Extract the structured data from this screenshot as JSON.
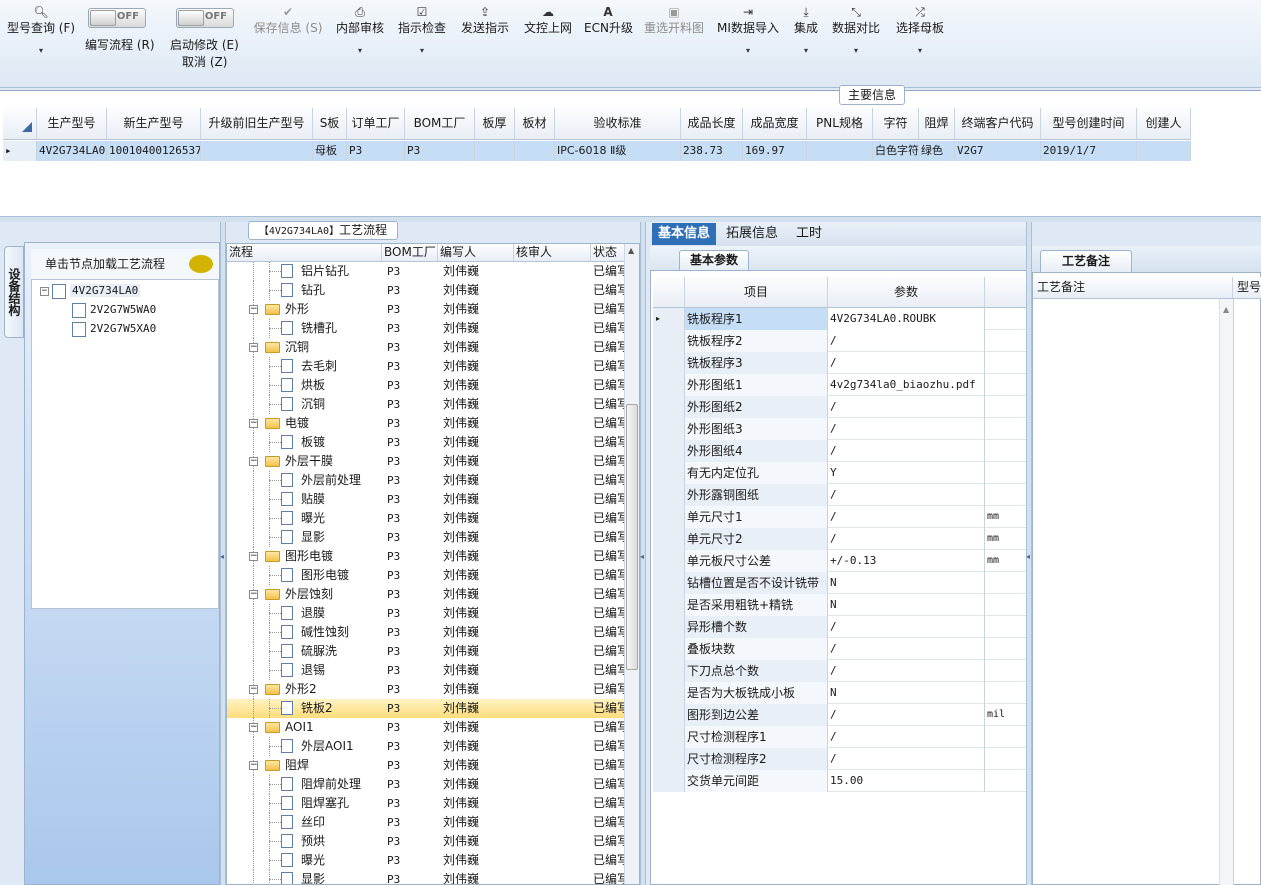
{
  "toolbar": {
    "buttons": [
      {
        "key": "model_query",
        "label": "型号查询 (F)",
        "icon": "search-icon",
        "disabled": false,
        "dropdown": true
      },
      {
        "key": "save_info",
        "label": "保存信息 (S)",
        "icon": "check-icon",
        "disabled": true,
        "dropdown": false
      },
      {
        "key": "internal_review",
        "label": "内部审核",
        "icon": "print-icon",
        "disabled": false,
        "dropdown": true
      },
      {
        "key": "instruction_check",
        "label": "指示检查",
        "icon": "checkbox-icon",
        "disabled": false,
        "dropdown": true
      },
      {
        "key": "send_instruction",
        "label": "发送指示",
        "icon": "upload-icon",
        "disabled": false,
        "dropdown": false
      },
      {
        "key": "doc_online",
        "label": "文控上网",
        "icon": "cloud-upload-icon",
        "disabled": false,
        "dropdown": false
      },
      {
        "key": "ecn_upgrade",
        "label": "ECN升级",
        "icon": "text-a-icon",
        "disabled": false,
        "dropdown": false
      },
      {
        "key": "reselect_drawing",
        "label": "重选开料图",
        "icon": "image-icon",
        "disabled": true,
        "dropdown": false
      },
      {
        "key": "mi_import",
        "label": "MI数据导入",
        "icon": "sign-in-icon",
        "disabled": false,
        "dropdown": true
      },
      {
        "key": "integrate",
        "label": "集成",
        "icon": "download-icon",
        "disabled": false,
        "dropdown": true
      },
      {
        "key": "data_compare",
        "label": "数据对比",
        "icon": "compress-icon",
        "disabled": false,
        "dropdown": true
      },
      {
        "key": "select_master",
        "label": "选择母板",
        "icon": "shuffle-icon",
        "disabled": false,
        "dropdown": true
      }
    ],
    "toggles": [
      {
        "key": "edit_flow",
        "state": "OFF",
        "label": "编写流程 (R)"
      },
      {
        "key": "start_modify",
        "state": "OFF",
        "label": "启动修改 (E)",
        "sublabel": "取消 (Z)"
      }
    ]
  },
  "main_info": {
    "section_title": "主要信息",
    "columns": [
      "生产型号",
      "新生产型号",
      "升级前旧生产型号",
      "S板",
      "订单工厂",
      "BOM工厂",
      "板厚",
      "板材",
      "验收标准",
      "成品长度",
      "成品宽度",
      "PNL规格",
      "字符",
      "阻焊",
      "终端客户代码",
      "型号创建时间",
      "创建人"
    ],
    "row": [
      "4V2G734LA0",
      "10010400126537",
      "",
      "母板",
      "P3",
      "P3",
      "",
      "",
      "IPC-6018 Ⅱ级",
      "238.73",
      "169.97",
      "",
      "白色字符",
      "绿色",
      "V2G7",
      "2019/1/7",
      ""
    ]
  },
  "left": {
    "vertical_tab": "设备结构",
    "header": "单击节点加载工艺流程",
    "tree": {
      "root": "4V2G734LA0",
      "children": [
        "2V2G7W5WA0",
        "2V2G7W5XA0"
      ]
    }
  },
  "process": {
    "tab_prefix": "【4V2G734LA0】",
    "tab_title": "工艺流程",
    "columns": [
      "流程",
      "BOM工厂",
      "编写人",
      "核审人",
      "状态"
    ],
    "rows": [
      {
        "level": 2,
        "name": "铝片钻孔",
        "bom": "P3",
        "author": "刘伟巍",
        "reviewer": "",
        "status": "已编写"
      },
      {
        "level": 2,
        "name": "钻孔",
        "bom": "P3",
        "author": "刘伟巍",
        "reviewer": "",
        "status": "已编写"
      },
      {
        "level": 1,
        "name": "外形",
        "bom": "P3",
        "author": "刘伟巍",
        "reviewer": "",
        "status": "已编写"
      },
      {
        "level": 2,
        "name": "铣槽孔",
        "bom": "P3",
        "author": "刘伟巍",
        "reviewer": "",
        "status": "已编写"
      },
      {
        "level": 1,
        "name": "沉铜",
        "bom": "P3",
        "author": "刘伟巍",
        "reviewer": "",
        "status": "已编写"
      },
      {
        "level": 2,
        "name": "去毛刺",
        "bom": "P3",
        "author": "刘伟巍",
        "reviewer": "",
        "status": "已编写"
      },
      {
        "level": 2,
        "name": "烘板",
        "bom": "P3",
        "author": "刘伟巍",
        "reviewer": "",
        "status": "已编写"
      },
      {
        "level": 2,
        "name": "沉铜",
        "bom": "P3",
        "author": "刘伟巍",
        "reviewer": "",
        "status": "已编写"
      },
      {
        "level": 1,
        "name": "电镀",
        "bom": "P3",
        "author": "刘伟巍",
        "reviewer": "",
        "status": "已编写"
      },
      {
        "level": 2,
        "name": "板镀",
        "bom": "P3",
        "author": "刘伟巍",
        "reviewer": "",
        "status": "已编写"
      },
      {
        "level": 1,
        "name": "外层干膜",
        "bom": "P3",
        "author": "刘伟巍",
        "reviewer": "",
        "status": "已编写"
      },
      {
        "level": 2,
        "name": "外层前处理",
        "bom": "P3",
        "author": "刘伟巍",
        "reviewer": "",
        "status": "已编写"
      },
      {
        "level": 2,
        "name": "贴膜",
        "bom": "P3",
        "author": "刘伟巍",
        "reviewer": "",
        "status": "已编写"
      },
      {
        "level": 2,
        "name": "曝光",
        "bom": "P3",
        "author": "刘伟巍",
        "reviewer": "",
        "status": "已编写"
      },
      {
        "level": 2,
        "name": "显影",
        "bom": "P3",
        "author": "刘伟巍",
        "reviewer": "",
        "status": "已编写"
      },
      {
        "level": 1,
        "name": "图形电镀",
        "bom": "P3",
        "author": "刘伟巍",
        "reviewer": "",
        "status": "已编写"
      },
      {
        "level": 2,
        "name": "图形电镀",
        "bom": "P3",
        "author": "刘伟巍",
        "reviewer": "",
        "status": "已编写"
      },
      {
        "level": 1,
        "name": "外层蚀刻",
        "bom": "P3",
        "author": "刘伟巍",
        "reviewer": "",
        "status": "已编写"
      },
      {
        "level": 2,
        "name": "退膜",
        "bom": "P3",
        "author": "刘伟巍",
        "reviewer": "",
        "status": "已编写"
      },
      {
        "level": 2,
        "name": "碱性蚀刻",
        "bom": "P3",
        "author": "刘伟巍",
        "reviewer": "",
        "status": "已编写"
      },
      {
        "level": 2,
        "name": "硫脲洗",
        "bom": "P3",
        "author": "刘伟巍",
        "reviewer": "",
        "status": "已编写"
      },
      {
        "level": 2,
        "name": "退锡",
        "bom": "P3",
        "author": "刘伟巍",
        "reviewer": "",
        "status": "已编写"
      },
      {
        "level": 1,
        "name": "外形2",
        "bom": "P3",
        "author": "刘伟巍",
        "reviewer": "",
        "status": "已编写"
      },
      {
        "level": 2,
        "name": "铣板2",
        "bom": "P3",
        "author": "刘伟巍",
        "reviewer": "",
        "status": "已编写",
        "selected": true
      },
      {
        "level": 1,
        "name": "AOI1",
        "bom": "P3",
        "author": "刘伟巍",
        "reviewer": "",
        "status": "已编写"
      },
      {
        "level": 2,
        "name": "外层AOI1",
        "bom": "P3",
        "author": "刘伟巍",
        "reviewer": "",
        "status": "已编写"
      },
      {
        "level": 1,
        "name": "阻焊",
        "bom": "P3",
        "author": "刘伟巍",
        "reviewer": "",
        "status": "已编写"
      },
      {
        "level": 2,
        "name": "阻焊前处理",
        "bom": "P3",
        "author": "刘伟巍",
        "reviewer": "",
        "status": "已编写"
      },
      {
        "level": 2,
        "name": "阻焊塞孔",
        "bom": "P3",
        "author": "刘伟巍",
        "reviewer": "",
        "status": "已编写"
      },
      {
        "level": 2,
        "name": "丝印",
        "bom": "P3",
        "author": "刘伟巍",
        "reviewer": "",
        "status": "已编写"
      },
      {
        "level": 2,
        "name": "预烘",
        "bom": "P3",
        "author": "刘伟巍",
        "reviewer": "",
        "status": "已编写"
      },
      {
        "level": 2,
        "name": "曝光",
        "bom": "P3",
        "author": "刘伟巍",
        "reviewer": "",
        "status": "已编写"
      },
      {
        "level": 2,
        "name": "显影",
        "bom": "P3",
        "author": "刘伟巍",
        "reviewer": "",
        "status": "已编写"
      }
    ]
  },
  "detail": {
    "tabs": [
      "基本信息",
      "拓展信息",
      "工时"
    ],
    "active_tab": "基本信息",
    "subtab": "基本参数",
    "columns": [
      "项目",
      "参数"
    ],
    "rows": [
      {
        "item": "铣板程序1",
        "value": "4V2G734LA0.ROUBK",
        "unit": ""
      },
      {
        "item": "铣板程序2",
        "value": "/",
        "unit": ""
      },
      {
        "item": "铣板程序3",
        "value": "/",
        "unit": ""
      },
      {
        "item": "外形图纸1",
        "value": "4v2g734la0_biaozhu.pdf",
        "unit": ""
      },
      {
        "item": "外形图纸2",
        "value": "/",
        "unit": ""
      },
      {
        "item": "外形图纸3",
        "value": "/",
        "unit": ""
      },
      {
        "item": "外形图纸4",
        "value": "/",
        "unit": ""
      },
      {
        "item": "有无内定位孔",
        "value": "Y",
        "unit": ""
      },
      {
        "item": "外形露铜图纸",
        "value": "/",
        "unit": ""
      },
      {
        "item": "单元尺寸1",
        "value": "/",
        "unit": "mm"
      },
      {
        "item": "单元尺寸2",
        "value": "/",
        "unit": "mm"
      },
      {
        "item": "单元板尺寸公差",
        "value": "+/-0.13",
        "unit": "mm"
      },
      {
        "item": "钻槽位置是否不设计铣带",
        "value": "N",
        "unit": ""
      },
      {
        "item": "是否采用粗铣+精铣",
        "value": "N",
        "unit": ""
      },
      {
        "item": "异形槽个数",
        "value": "/",
        "unit": ""
      },
      {
        "item": "叠板块数",
        "value": "/",
        "unit": ""
      },
      {
        "item": "下刀点总个数",
        "value": "/",
        "unit": ""
      },
      {
        "item": "是否为大板铣成小板",
        "value": "N",
        "unit": ""
      },
      {
        "item": "图形到边公差",
        "value": "/",
        "unit": "mil"
      },
      {
        "item": "尺寸检测程序1",
        "value": "/",
        "unit": ""
      },
      {
        "item": "尺寸检测程序2",
        "value": "/",
        "unit": ""
      },
      {
        "item": "交货单元间距",
        "value": "15.00",
        "unit": ""
      }
    ]
  },
  "remarks": {
    "subtab": "工艺备注",
    "columns": [
      "工艺备注",
      "型号"
    ]
  }
}
